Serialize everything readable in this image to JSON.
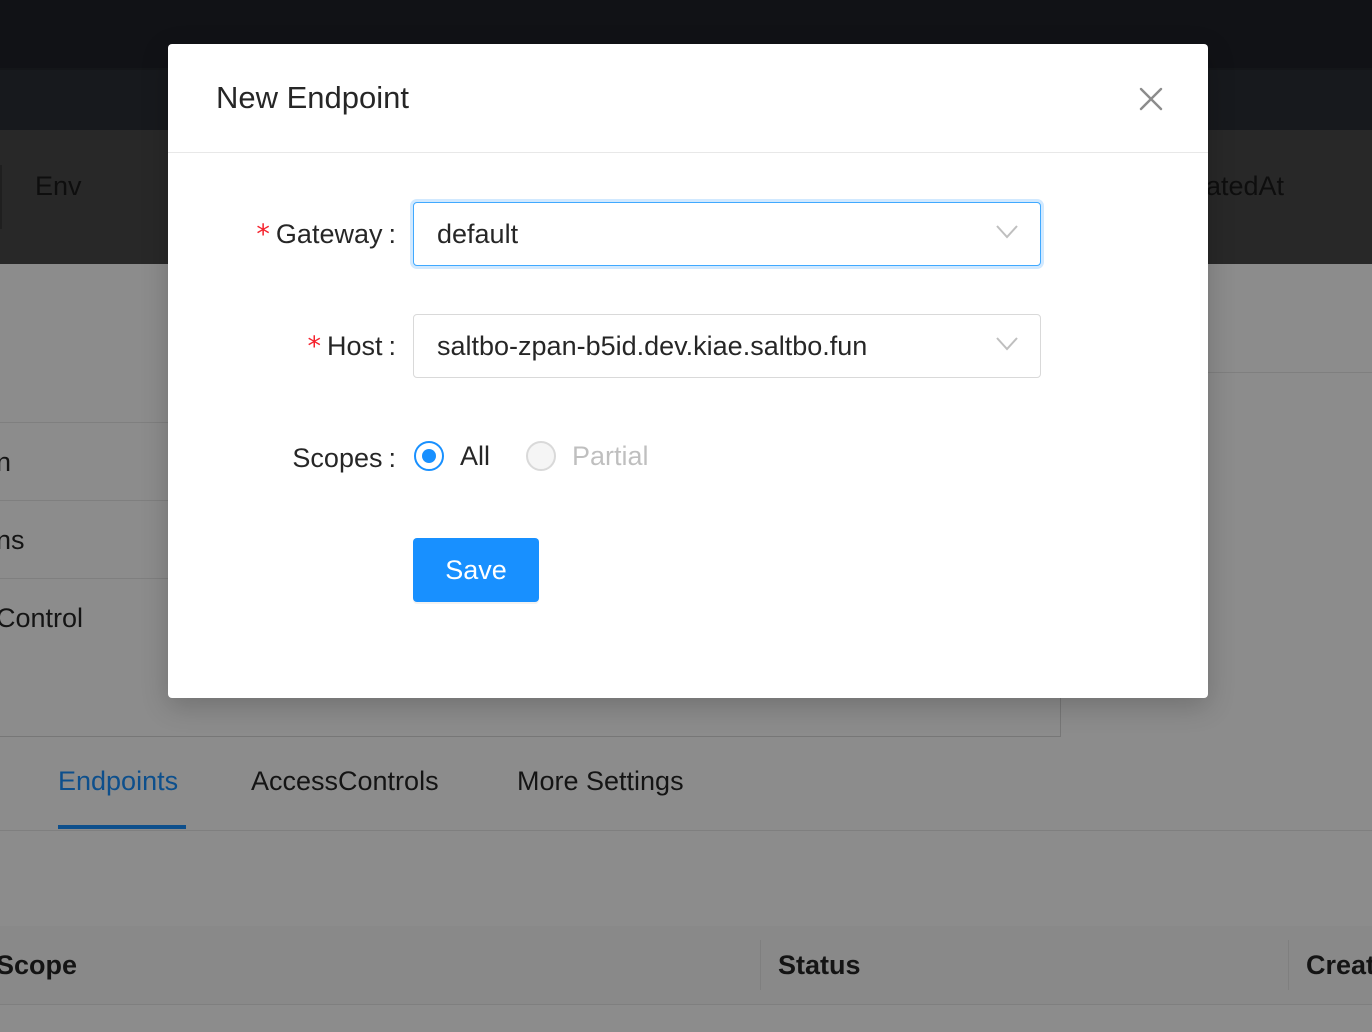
{
  "background": {
    "table_header": {
      "env": "Env",
      "created_at_partial": "atedAt"
    },
    "rows": [
      {
        "text": "n"
      },
      {
        "text": "ns"
      },
      {
        "text": "Control"
      }
    ],
    "tabs": [
      {
        "label": "Endpoints",
        "active": true
      },
      {
        "label": "AccessControls",
        "active": false
      },
      {
        "label": "More Settings",
        "active": false
      }
    ],
    "endpoints_table_header": {
      "scope": "Scope",
      "status": "Status",
      "created_partial": "Creat"
    }
  },
  "modal": {
    "title": "New Endpoint",
    "close_icon": "close-icon",
    "form": {
      "gateway": {
        "label": "Gateway",
        "required": true,
        "value": "default"
      },
      "host": {
        "label": "Host",
        "required": true,
        "value": "saltbo-zpan-b5id.dev.kiae.saltbo.fun"
      },
      "scopes": {
        "label": "Scopes",
        "options": [
          {
            "label": "All",
            "checked": true,
            "disabled": false
          },
          {
            "label": "Partial",
            "checked": false,
            "disabled": true
          }
        ]
      },
      "required_mark": "*",
      "colon": ":"
    },
    "save_label": "Save"
  },
  "colors": {
    "primary": "#1890ff",
    "required": "#f5222d",
    "mask": "rgba(0,0,0,0.45)"
  }
}
